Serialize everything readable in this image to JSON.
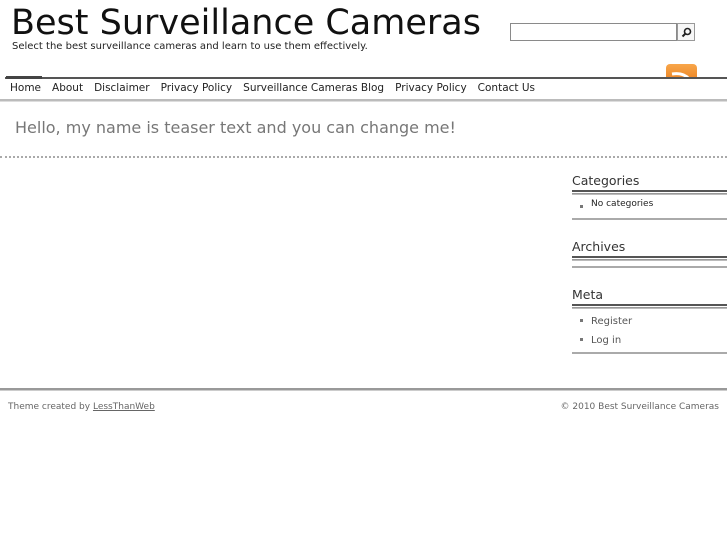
{
  "header": {
    "title": "Best Surveillance Cameras",
    "tagline": "Select the best surveillance cameras and learn to use them effectively."
  },
  "search": {
    "value": "",
    "placeholder": "",
    "button_icon": "search-icon"
  },
  "rss": {
    "icon": "rss-feed-icon",
    "color": "#f39a3a"
  },
  "nav": {
    "items": [
      {
        "label": "Home",
        "active": true
      },
      {
        "label": "About"
      },
      {
        "label": "Disclaimer"
      },
      {
        "label": "Privacy Policy"
      },
      {
        "label": "Surveillance Cameras Blog"
      },
      {
        "label": "Privacy Policy"
      },
      {
        "label": "Contact Us"
      }
    ]
  },
  "teaser": "Hello, my name is teaser text and you can change me!",
  "sidebar": {
    "categories": {
      "title": "Categories",
      "items": [
        "No categories"
      ]
    },
    "archives": {
      "title": "Archives"
    },
    "meta": {
      "title": "Meta",
      "items": [
        "Register",
        "Log in"
      ]
    }
  },
  "footer": {
    "credit_prefix": "Theme created by",
    "credit_link": "LessThanWeb",
    "copyright": "© 2010 Best Surveillance Cameras"
  }
}
